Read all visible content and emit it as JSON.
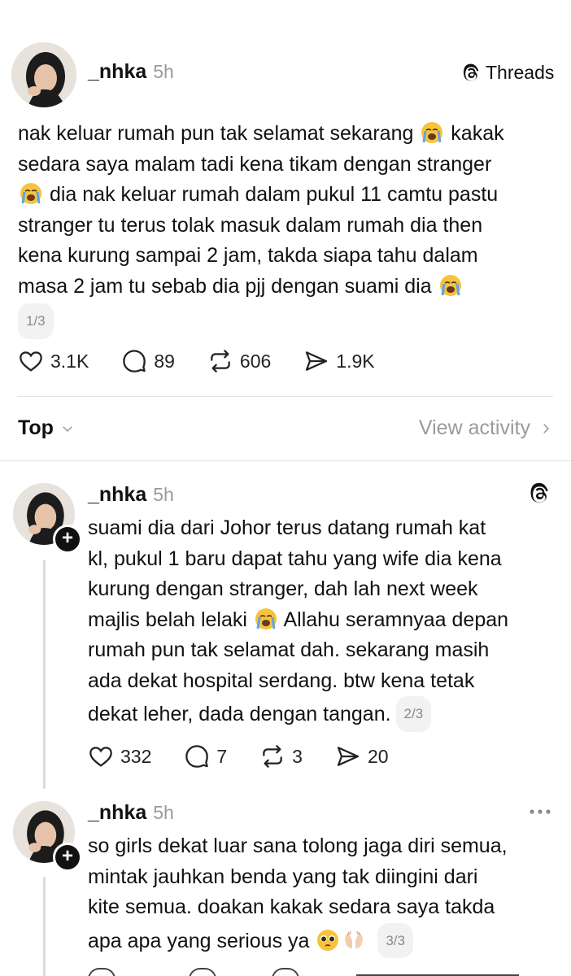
{
  "header": {
    "brand_label": "Threads"
  },
  "main_post": {
    "username": "_nhka",
    "time": "5h",
    "text_lines": [
      "nak keluar rumah pun tak selamat sekarang",
      "kakak",
      "sedara saya malam tadi kena tikam dengan stranger",
      "dia nak keluar rumah dalam pukul 11 camtu pastu",
      "stranger tu terus tolak masuk dalam rumah dia then",
      "kena kurung sampai 2 jam, takda siapa tahu dalam",
      "masa 2 jam tu sebab dia pjj dengan suami dia"
    ],
    "page_indicator": "1/3",
    "likes": "3.1K",
    "replies": "89",
    "reposts": "606",
    "shares": "1.9K"
  },
  "sort_bar": {
    "sort_label": "Top",
    "activity_label": "View activity"
  },
  "reply_1": {
    "username": "_nhka",
    "time": "5h",
    "text_lines": [
      "suami dia dari Johor terus datang rumah kat",
      "kl, pukul 1 baru dapat tahu yang wife dia kena",
      "kurung dengan stranger, dah lah next week",
      "majlis belah lelaki",
      "Allahu seramnyaa depan",
      "rumah pun tak selamat dah. sekarang masih",
      "ada dekat hospital serdang. btw kena tetak",
      "dekat leher, dada dengan tangan."
    ],
    "page_indicator": "2/3",
    "likes": "332",
    "replies": "7",
    "reposts": "3",
    "shares": "20"
  },
  "reply_2": {
    "username": "_nhka",
    "time": "5h",
    "text_lines": [
      "so girls dekat luar sana tolong jaga diri semua,",
      "mintak jauhkan benda yang tak diingini dari",
      "kite semua. doakan kakak sedara saya takda",
      "apa apa yang serious ya"
    ],
    "page_indicator": "3/3"
  },
  "icons": {
    "threads_logo": "threads-logo-icon",
    "like": "heart-icon",
    "reply": "comment-icon",
    "repost": "repost-icon",
    "share": "send-icon",
    "more": "more-icon",
    "emoji_cry": "loudly-crying-face-icon",
    "emoji_plead": "pleading-face-icon",
    "emoji_pray": "palms-up-icon"
  }
}
